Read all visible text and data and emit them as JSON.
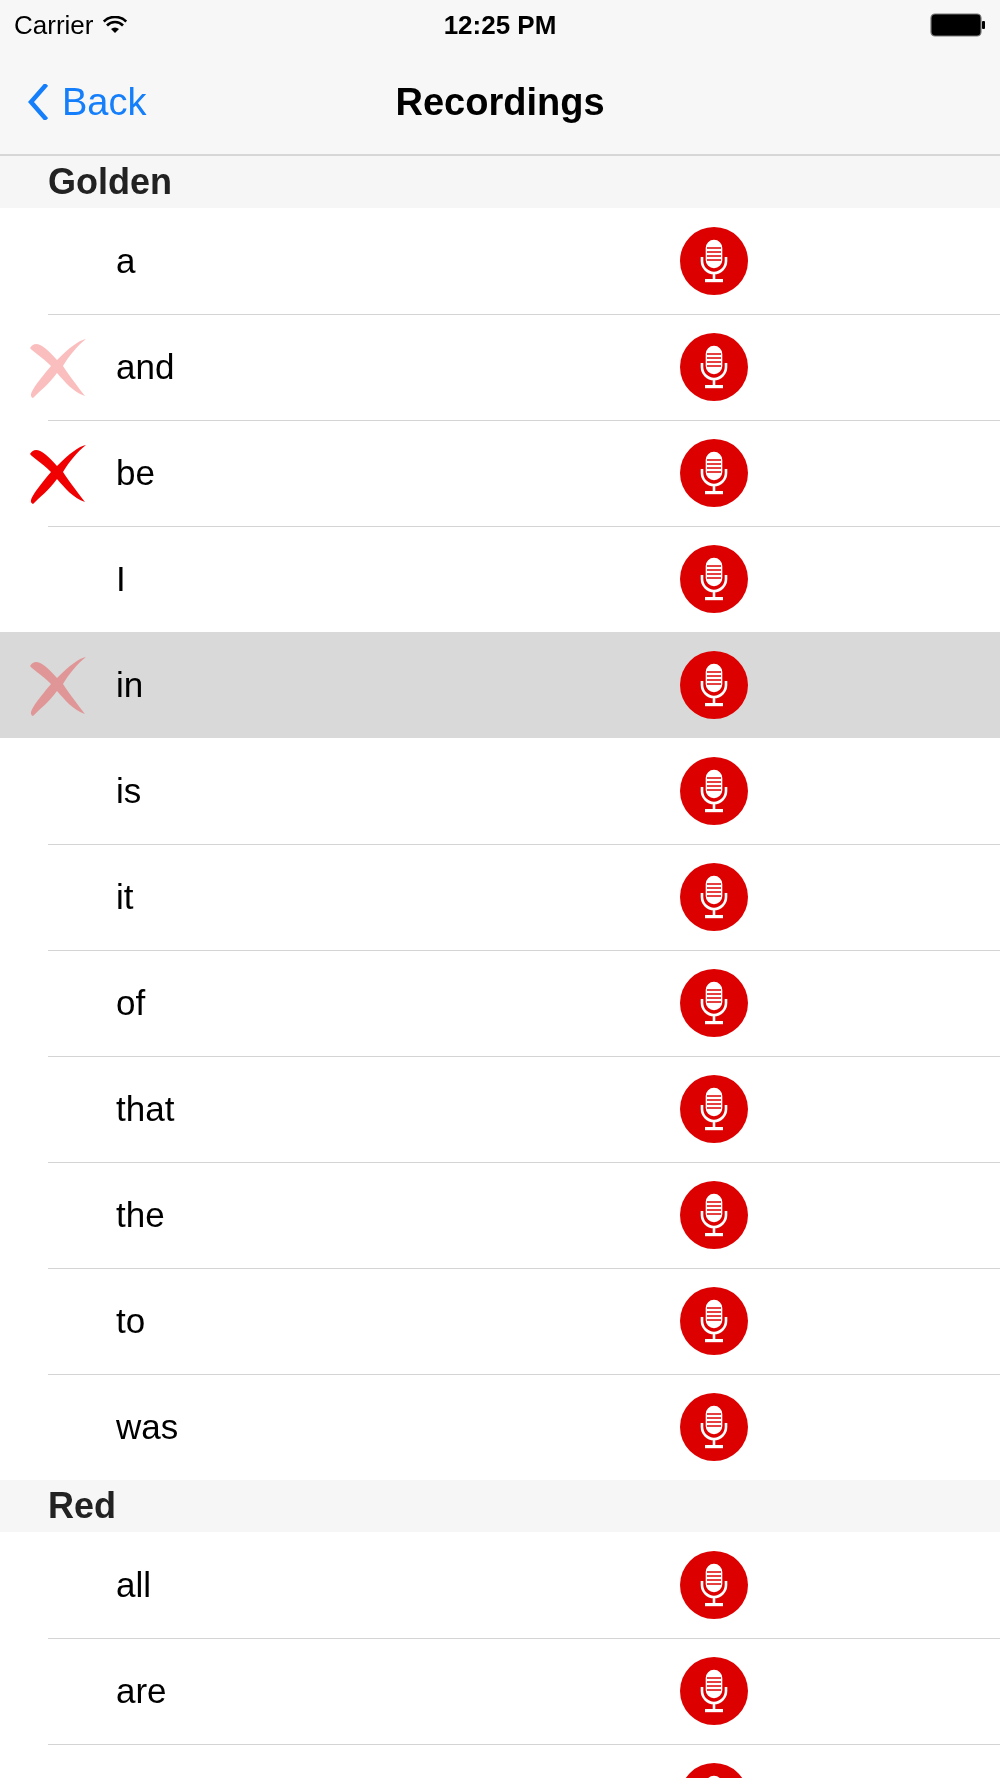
{
  "status_bar": {
    "carrier": "Carrier",
    "time": "12:25 PM"
  },
  "nav_bar": {
    "back": "Back",
    "title": "Recordings"
  },
  "sections": [
    {
      "title": "Golden",
      "rows": [
        {
          "word": "a",
          "kind": "plain",
          "selected": false
        },
        {
          "word": "and",
          "kind": "faded",
          "selected": false
        },
        {
          "word": "be",
          "kind": "crossed",
          "selected": false
        },
        {
          "word": "I",
          "kind": "plain",
          "selected": false
        },
        {
          "word": "in",
          "kind": "faded",
          "selected": true
        },
        {
          "word": "is",
          "kind": "plain",
          "selected": false
        },
        {
          "word": "it",
          "kind": "plain",
          "selected": false
        },
        {
          "word": "of",
          "kind": "plain",
          "selected": false
        },
        {
          "word": "that",
          "kind": "plain",
          "selected": false
        },
        {
          "word": "the",
          "kind": "plain",
          "selected": false
        },
        {
          "word": "to",
          "kind": "plain",
          "selected": false
        },
        {
          "word": "was",
          "kind": "plain",
          "selected": false
        }
      ]
    },
    {
      "title": "Red",
      "rows": [
        {
          "word": "all",
          "kind": "plain",
          "selected": false
        },
        {
          "word": "are",
          "kind": "plain",
          "selected": false
        },
        {
          "kind": "plain",
          "selected": false
        }
      ]
    }
  ]
}
